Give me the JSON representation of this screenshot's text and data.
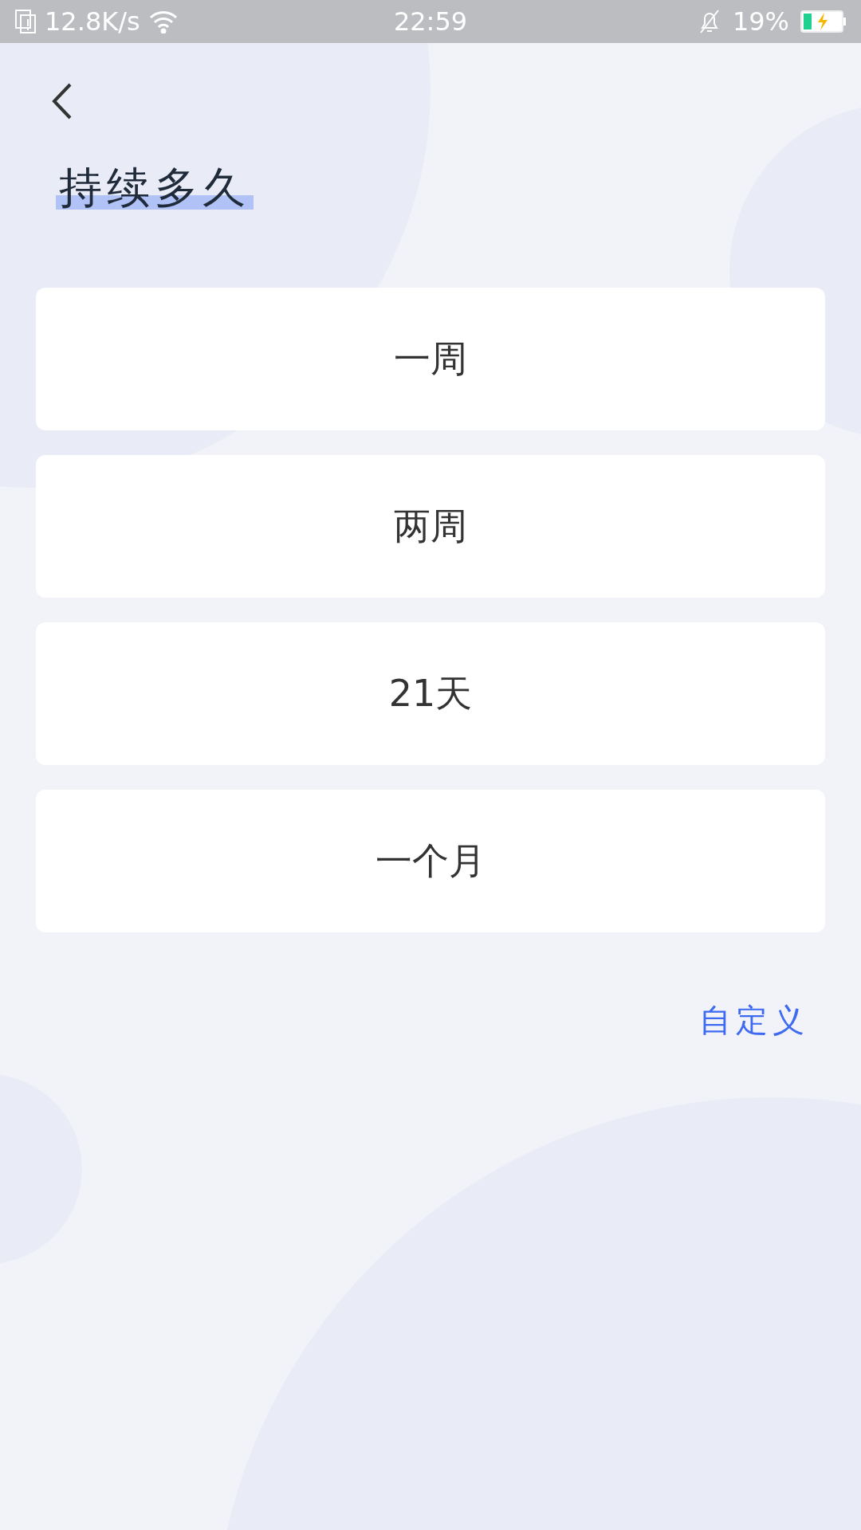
{
  "status_bar": {
    "speed": "12.8K/s",
    "time": "22:59",
    "battery": "19%"
  },
  "title": "持续多久",
  "options": [
    {
      "label": "一周"
    },
    {
      "label": "两周"
    },
    {
      "label": "21天"
    },
    {
      "label": "一个月"
    }
  ],
  "custom_link": "自定义"
}
